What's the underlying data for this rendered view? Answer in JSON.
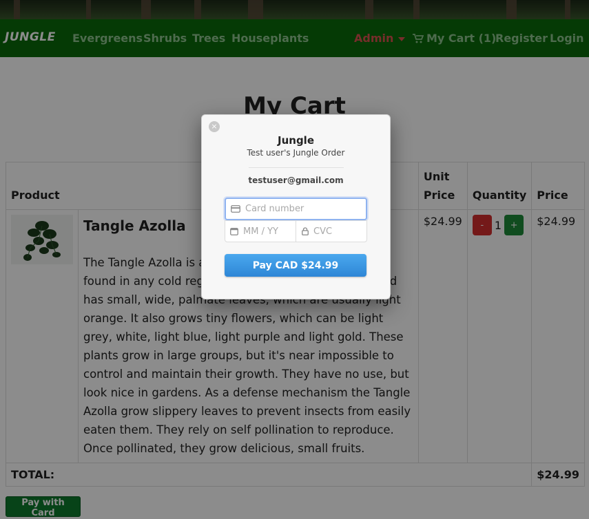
{
  "nav": {
    "brand": "JUNGLE",
    "categories": [
      "Evergreens",
      "Shrubs",
      "Trees",
      "Houseplants"
    ],
    "admin": "Admin",
    "cart": "My Cart (1)",
    "register": "Register",
    "login": "Login"
  },
  "page": {
    "title": "My Cart"
  },
  "table": {
    "headers": {
      "product": "Product",
      "unit_price": "Unit Price",
      "quantity": "Quantity",
      "price": "Price"
    },
    "row": {
      "name": "Tangle Azolla",
      "description": "The Tangle Azolla is a very common plant that can be found in any cold region. It blooms during summer and has small, wide, palmate leaves, which are usually light orange. It also grows tiny flowers, which can be light grey, white, light blue, light purple and light gold. These plants grow in large groups, but it's near impossible to control and maintain their growth. They have no use, but look nice in gardens. As a defense mechanism the Tangle Azolla grow slippery leaves to prevent insects from easily eaten them. They rely on self pollination to reproduce. Once pollinated, they grow delicious, small fruits.",
      "unit_price": "$24.99",
      "quantity": "1",
      "minus": "-",
      "plus": "+",
      "price": "$24.99"
    },
    "total_label": "TOTAL:",
    "total_value": "$24.99"
  },
  "pay_button": "Pay with Card",
  "checkout": {
    "close": "×",
    "title": "Jungle",
    "subtitle": "Test user's Jungle Order",
    "email": "testuser@gmail.com",
    "card_placeholder": "Card number",
    "expiry_placeholder": "MM / YY",
    "cvc_placeholder": "CVC",
    "pay_label": "Pay CAD $24.99"
  },
  "colors": {
    "navbar": "#0a6b0a",
    "nav_link": "#8fc38f",
    "admin": "#d9534f",
    "pay_blue": "#2e86d6"
  }
}
